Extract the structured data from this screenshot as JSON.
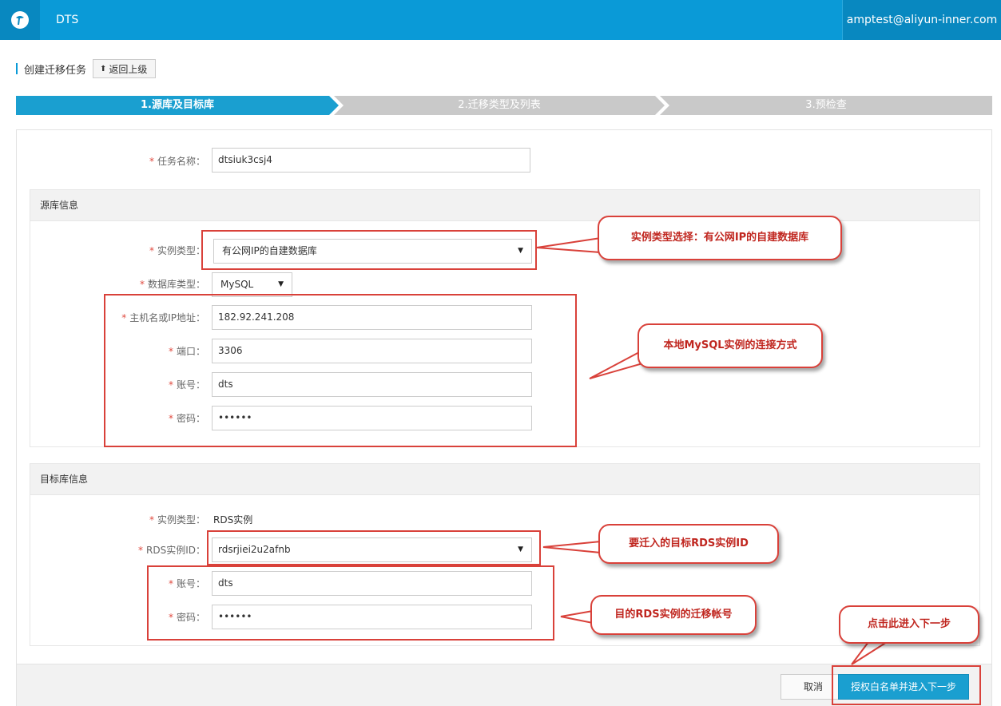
{
  "topbar": {
    "app_title": "DTS",
    "user": "amptest@aliyun-inner.com",
    "logo_icon": "aliyun-logo-icon"
  },
  "header": {
    "title": "创建迁移任务",
    "back_label": "返回上级"
  },
  "steps": [
    {
      "label": "1.源库及目标库",
      "active": true
    },
    {
      "label": "2.迁移类型及列表",
      "active": false
    },
    {
      "label": "3.预检查",
      "active": false
    }
  ],
  "task": {
    "name_label": "任务名称：",
    "name_value": "dtsiuk3csj4"
  },
  "source": {
    "section_title": "源库信息",
    "instance_type_label": "实例类型：",
    "instance_type_value": "有公网IP的自建数据库",
    "db_type_label": "数据库类型：",
    "db_type_value": "MySQL",
    "host_label": "主机名或IP地址：",
    "host_value": "182.92.241.208",
    "port_label": "端口：",
    "port_value": "3306",
    "account_label": "账号：",
    "account_value": "dts",
    "password_label": "密码：",
    "password_value": "••••••"
  },
  "target": {
    "section_title": "目标库信息",
    "instance_type_label": "实例类型：",
    "instance_type_value": "RDS实例",
    "rds_id_label": "RDS实例ID：",
    "rds_id_value": "rdsrjiei2u2afnb",
    "account_label": "账号：",
    "account_value": "dts",
    "password_label": "密码：",
    "password_value": "••••••"
  },
  "footer": {
    "cancel_label": "取消",
    "next_label": "授权白名单并进入下一步"
  },
  "callouts": {
    "instance_type": "实例类型选择：有公网IP的自建数据库",
    "local_mysql": "本地MySQL实例的连接方式",
    "target_rds": "要迁入的目标RDS实例ID",
    "rds_account": "目的RDS实例的迁移帐号",
    "next_step": "点击此进入下一步"
  },
  "colors": {
    "primary": "#0a9ad7",
    "annotation": "#d9413a",
    "required": "#e04a3f"
  }
}
